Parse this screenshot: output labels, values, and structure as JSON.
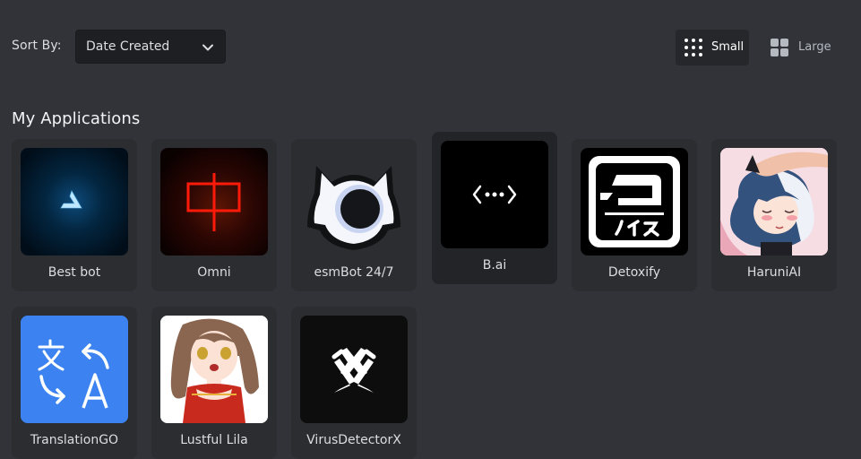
{
  "toolbar": {
    "sort_label": "Sort By:",
    "sort_value": "Date Created",
    "sort_icon": "chevron-down-icon",
    "view_small_label": "Small",
    "view_small_icon": "grid-dots-icon",
    "view_large_label": "Large",
    "view_large_icon": "grid-squares-icon",
    "selected_view": "Small"
  },
  "heading": "My Applications",
  "applications": [
    {
      "name": "Best bot",
      "icon": "triangle-logo-icon",
      "bg": "#011526"
    },
    {
      "name": "Omni",
      "icon": "red-chinese-character-icon",
      "bg": "#1a0503"
    },
    {
      "name": "esmBot 24/7",
      "icon": "esmbot-mascot-icon",
      "bg": "#2b2d31"
    },
    {
      "name": "B.ai",
      "icon": "code-dots-icon",
      "bg": "#000000"
    },
    {
      "name": "Detoxify",
      "icon": "detoxify-noise-logo-icon",
      "bg": "#000000"
    },
    {
      "name": "HaruniAI",
      "icon": "anime-girl-avatar-icon",
      "bg": "#f3d6de"
    },
    {
      "name": "TranslationGO",
      "icon": "translate-icon",
      "bg": "#3b82f0"
    },
    {
      "name": "Lustful Lila",
      "icon": "anime-girl-avatar-icon",
      "bg": "#ffffff"
    },
    {
      "name": "VirusDetectorX",
      "icon": "x-logo-icon",
      "bg": "#0d0d0d"
    }
  ]
}
